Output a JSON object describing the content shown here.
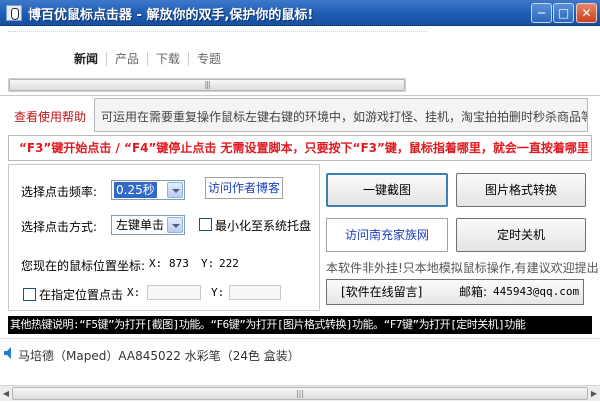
{
  "window": {
    "title": "博百优鼠标点击器 - 解放你的双手,保护你的鼠标!",
    "icon": "mouse-icon",
    "controls": {
      "minimize": "─",
      "maximize": "□",
      "close": "✕"
    }
  },
  "web": {
    "tabs": [
      {
        "label": "新闻",
        "active": true
      },
      {
        "label": "产品",
        "active": false
      },
      {
        "label": "下载",
        "active": false
      },
      {
        "label": "专题",
        "active": false
      }
    ],
    "scroll_grip": "|||"
  },
  "help": {
    "label": "查看使用帮助",
    "text": "可运用在需要重复操作鼠标左键右键的环境中，如游戏打怪、挂机，淘宝拍拍删时秒杀商品等…"
  },
  "hotkey_banner": "“F3”键开始点击 / “F4”键停止点击    无需设置脚本，只要按下“F3”键，鼠标指着哪里，就会一直按着哪里！",
  "controls": {
    "frequency_label": "选择点击频率:",
    "frequency_value": "0.25秒",
    "author_blog": "访问作者博客",
    "mode_label": "选择点击方式:",
    "mode_value": "左键单击",
    "minimize_tray_label": "最小化至系统托盘",
    "position_label": "您现在的鼠标位置坐标:",
    "pos_x_label": "X:",
    "pos_x_value": "873",
    "pos_y_label": "Y:",
    "pos_y_value": "222",
    "fixed_pos_label": "在指定位置点击",
    "fixed_x_label": "X:",
    "fixed_y_label": "Y:"
  },
  "buttons": {
    "screenshot": "一键截图",
    "image_convert": "图片格式转换",
    "visit_site": "访问南充家族网",
    "shutdown_timer": "定时关机"
  },
  "notice": "本软件非外挂!只本地模拟鼠标操作,有建议欢迎提出",
  "feedback": {
    "label": "[软件在线留言]",
    "email_label": "邮箱:",
    "email": "445943@qq.com"
  },
  "hint_bar": "其他热键说明:“F5键”为打开[截图]功能。“F6键”为打开[图片格式转换]功能。“F7键”为打开[定时关机]功能",
  "ad": {
    "icon": "speaker-icon",
    "text": "马培德（Maped）AA845022 水彩笔（24色 盒装）"
  },
  "colors": {
    "titlebar": "#1f5cb4",
    "help_label": "#c0141b",
    "banner_text": "#e1191e",
    "link_text": "#1b3fc4",
    "hint_bar_bg": "#000000"
  }
}
